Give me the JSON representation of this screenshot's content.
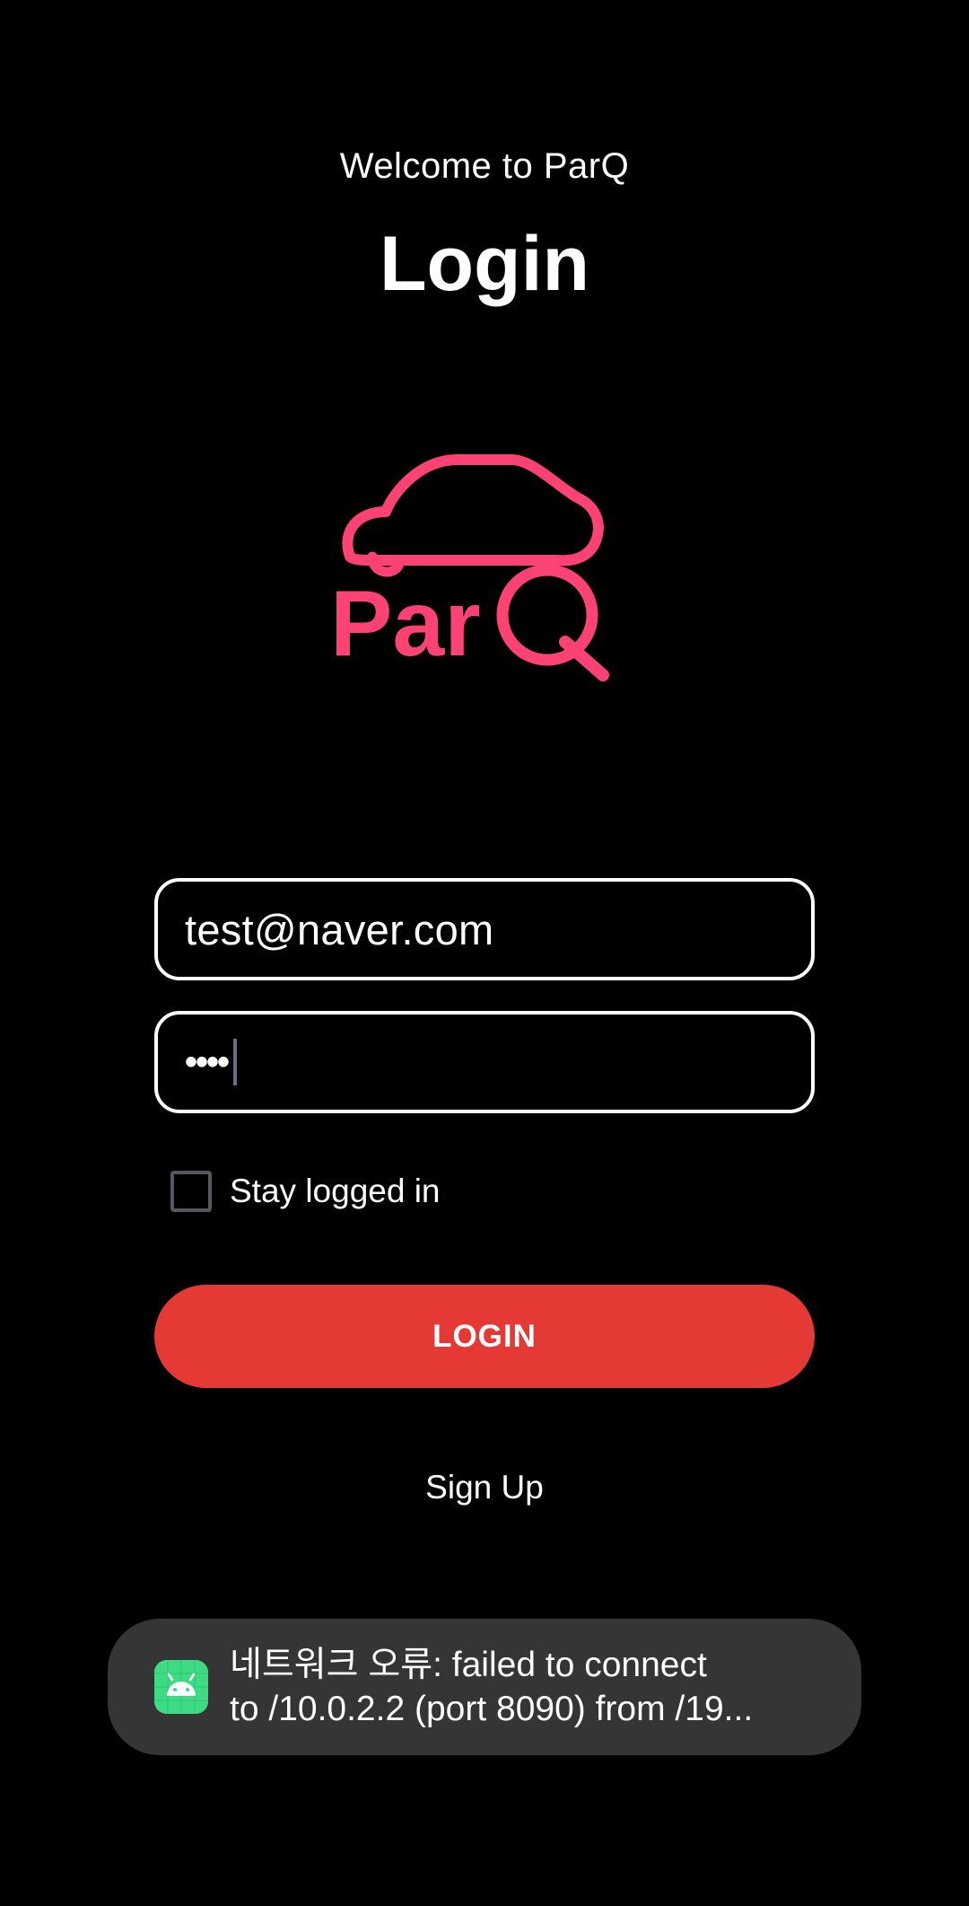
{
  "header": {
    "welcome": "Welcome to ParQ",
    "title": "Login"
  },
  "logo": {
    "text": "ParQ",
    "color": "#ff4274"
  },
  "form": {
    "email_value": "test@naver.com",
    "password_value": "••••",
    "stay_logged_in_label": "Stay logged in",
    "stay_logged_in_checked": false
  },
  "actions": {
    "login_label": "LOGIN",
    "signup_label": "Sign Up",
    "login_color": "#e53935"
  },
  "toast": {
    "icon": "android-icon",
    "line1": "네트워크 오류: failed to connect",
    "line2": "to /10.0.2.2 (port 8090) from /19..."
  }
}
